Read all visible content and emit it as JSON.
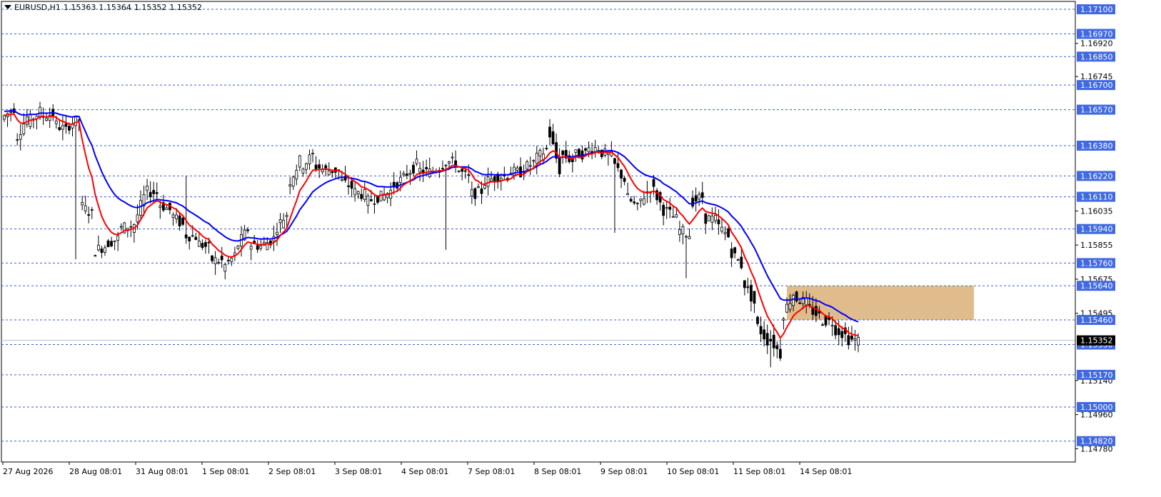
{
  "header": {
    "symbol": "EURUSD,H1",
    "open": "1.15363",
    "high": "1.15364",
    "low": "1.15352",
    "close": "1.15352",
    "menu_icon": "triangle-down-icon"
  },
  "chart_data": {
    "type": "candlestick",
    "title": "EURUSD,H1",
    "ylim": [
      1.147,
      1.172
    ],
    "grid": false,
    "price_axis_ticks": [
      "1.16920",
      "1.16745",
      "1.16035",
      "1.15855",
      "1.15675",
      "1.15495",
      "1.15140",
      "1.14960",
      "1.14780"
    ],
    "time_axis_labels": [
      "27 Aug 2026",
      "28 Aug 08:01",
      "31 Aug 08:01",
      "1 Sep 08:01",
      "2 Sep 08:01",
      "3 Sep 08:01",
      "4 Sep 08:01",
      "7 Sep 08:01",
      "8 Sep 08:01",
      "9 Sep 08:01",
      "10 Sep 08:01",
      "11 Sep 08:01",
      "14 Sep 08:01"
    ],
    "levels": [
      {
        "price": 1.171,
        "label": "1.17100"
      },
      {
        "price": 1.1697,
        "label": "1.16970"
      },
      {
        "price": 1.1685,
        "label": "1.16850"
      },
      {
        "price": 1.167,
        "label": "1.16700"
      },
      {
        "price": 1.1657,
        "label": "1.16570"
      },
      {
        "price": 1.1638,
        "label": "1.16380"
      },
      {
        "price": 1.1622,
        "label": "1.16220"
      },
      {
        "price": 1.1611,
        "label": "1.16110"
      },
      {
        "price": 1.1594,
        "label": "1.15940"
      },
      {
        "price": 1.1576,
        "label": "1.15760"
      },
      {
        "price": 1.1564,
        "label": "1.15640"
      },
      {
        "price": 1.1546,
        "label": "1.15460"
      },
      {
        "price": 1.1533,
        "label": "1.15330"
      },
      {
        "price": 1.1517,
        "label": "1.15170"
      },
      {
        "price": 1.15,
        "label": "1.15000"
      },
      {
        "price": 1.1482,
        "label": "1.14820"
      }
    ],
    "current_price": {
      "price": 1.15352,
      "label": "1.15352"
    },
    "zone": {
      "top": 1.1564,
      "bottom": 1.1546,
      "color": "#deb887"
    },
    "ema_fast_color": "#ff0000",
    "ema_slow_color": "#0000ff",
    "level_color": "#3a5fcd",
    "tag_color": "#4169e1",
    "price_path": [
      [
        1.1652,
        1.1658
      ],
      [
        1.164,
        1.1653
      ],
      [
        1.165,
        1.1656
      ],
      [
        1.1653,
        1.1655
      ],
      [
        1.165,
        1.1646
      ],
      [
        1.1648,
        1.1652
      ],
      [
        1.1607,
        1.1602
      ],
      [
        1.1582,
        1.1585
      ],
      [
        1.1586,
        1.1589
      ],
      [
        1.1594,
        1.1596
      ],
      [
        1.1592,
        1.1611
      ],
      [
        1.1614,
        1.1613
      ],
      [
        1.1608,
        1.1604
      ],
      [
        1.1602,
        1.1596
      ],
      [
        1.1591,
        1.159
      ],
      [
        1.1587,
        1.1584
      ],
      [
        1.1578,
        1.1577
      ],
      [
        1.1573,
        1.158
      ],
      [
        1.1583,
        1.1594
      ],
      [
        1.1586,
        1.1585
      ],
      [
        1.1585,
        1.1589
      ],
      [
        1.1593,
        1.1602
      ],
      [
        1.1616,
        1.163
      ],
      [
        1.1626,
        1.1633
      ],
      [
        1.1628,
        1.1625
      ],
      [
        1.1625,
        1.1625
      ],
      [
        1.162,
        1.1616
      ],
      [
        1.1614,
        1.1612
      ],
      [
        1.1608,
        1.1611
      ],
      [
        1.161,
        1.1614
      ],
      [
        1.1616,
        1.1621
      ],
      [
        1.1622,
        1.1628
      ],
      [
        1.1625,
        1.1624
      ],
      [
        1.1624,
        1.1628
      ],
      [
        1.163,
        1.1629
      ],
      [
        1.1626,
        1.1621
      ],
      [
        1.1612,
        1.1614
      ],
      [
        1.1618,
        1.1621
      ],
      [
        1.1622,
        1.1622
      ],
      [
        1.1624,
        1.1624
      ],
      [
        1.1625,
        1.1629
      ],
      [
        1.163,
        1.1636
      ],
      [
        1.165,
        1.1625
      ],
      [
        1.1634,
        1.163
      ],
      [
        1.1633,
        1.1634
      ],
      [
        1.1636,
        1.1637
      ],
      [
        1.1635,
        1.1632
      ],
      [
        1.163,
        1.162
      ],
      [
        1.1612,
        1.1605
      ],
      [
        1.1607,
        1.1616
      ],
      [
        1.1618,
        1.1604
      ],
      [
        1.1605,
        1.1599
      ],
      [
        1.1594,
        1.1591
      ],
      [
        1.1608,
        1.1611
      ],
      [
        1.16,
        1.1599
      ],
      [
        1.1597,
        1.159
      ],
      [
        1.1584,
        1.1575
      ],
      [
        1.1568,
        1.1555
      ],
      [
        1.1545,
        1.1535
      ],
      [
        1.1538,
        1.1528
      ],
      [
        1.1546,
        1.156
      ],
      [
        1.1558,
        1.1555
      ],
      [
        1.1553,
        1.1548
      ],
      [
        1.1546,
        1.1545
      ],
      [
        1.1542,
        1.1538
      ],
      [
        1.1536,
        1.1535
      ]
    ]
  }
}
